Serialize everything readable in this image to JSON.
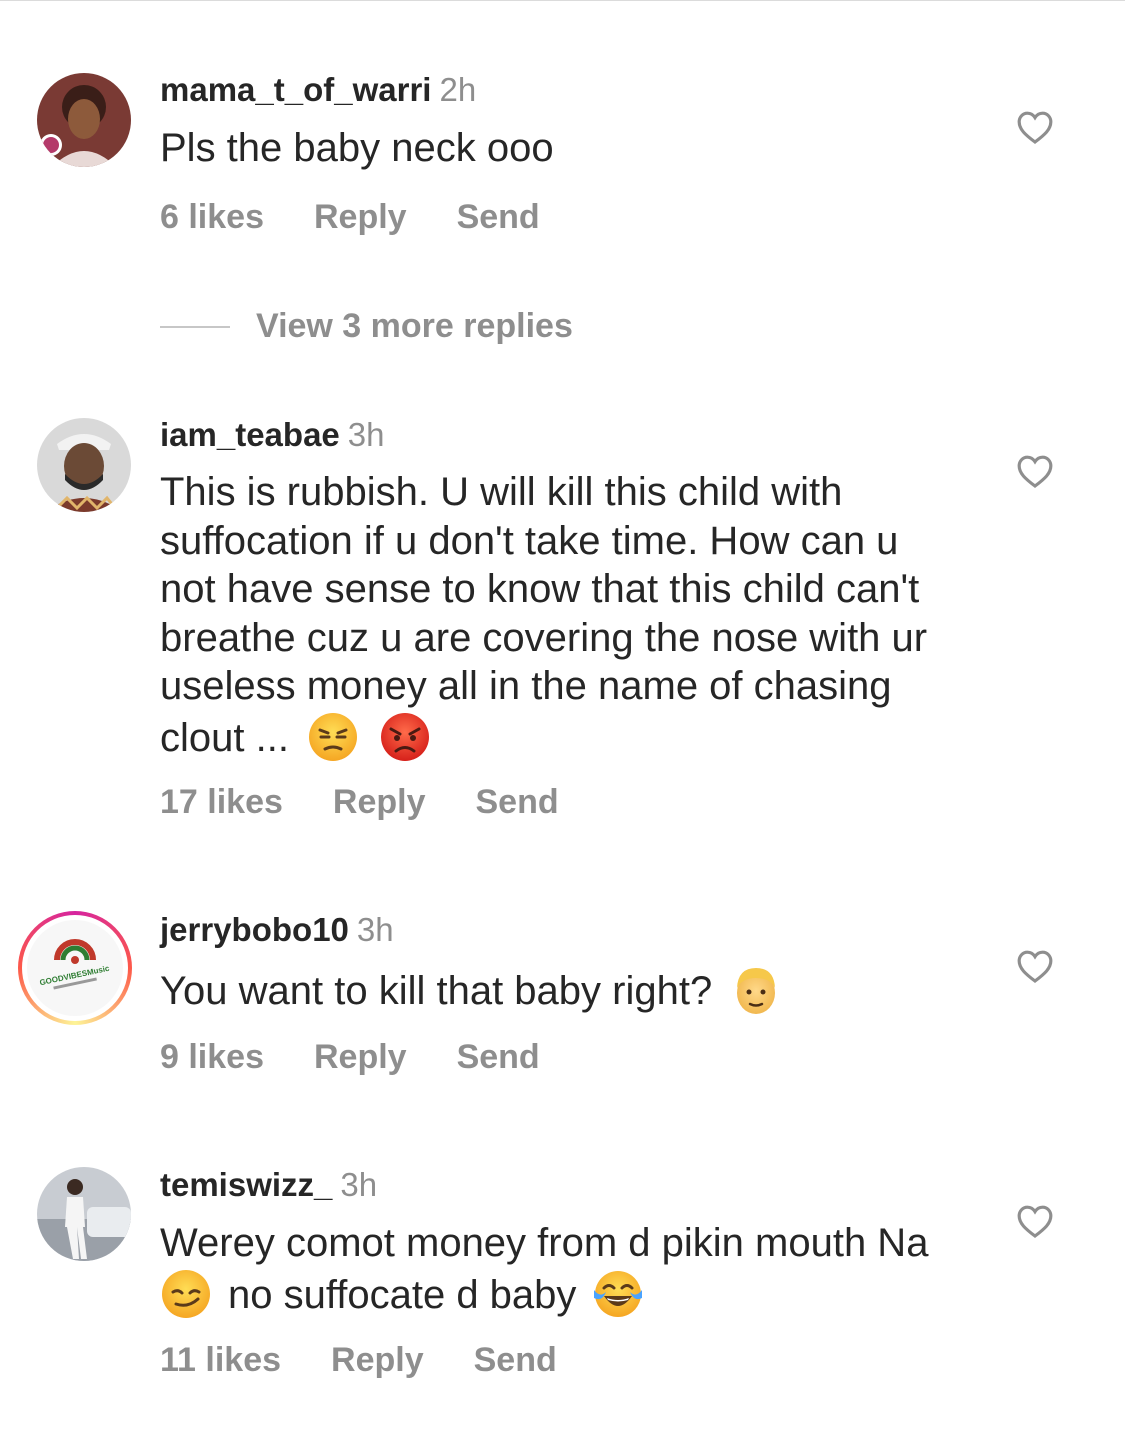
{
  "comments": [
    {
      "username": "mama_t_of_warri",
      "time": "2h",
      "text": "Pls the baby neck ooo",
      "likes": "6 likes",
      "reply": "Reply",
      "send": "Send"
    },
    {
      "username": "iam_teabae",
      "time": "3h",
      "text": "This is rubbish.  U will kill this child with suffocation if u don't take time. How can u not have sense to know that this child can't breathe cuz u are covering the nose with ur useless money all in the name of chasing clout ...",
      "likes": "17 likes",
      "reply": "Reply",
      "send": "Send"
    },
    {
      "username": "jerrybobo10",
      "time": "3h",
      "text": "You want to kill that baby right?",
      "likes": "9 likes",
      "reply": "Reply",
      "send": "Send",
      "avatar_logo_text": "GOODVIBESMusic"
    },
    {
      "username": "temiswizz_",
      "time": "3h",
      "text_part1": "Werey comot money from d pikin mouth Na",
      "text_part2": "no suffocate d baby",
      "likes": "11 likes",
      "reply": "Reply",
      "send": "Send"
    }
  ],
  "view_replies": "View 3 more replies",
  "icons": {
    "like": "heart-outline-icon",
    "emoji_1": "unamused-face-emoji",
    "emoji_2": "pouting-face-emoji",
    "emoji_3": "man-blond-hair-emoji",
    "emoji_4": "smirking-face-emoji",
    "emoji_5": "tears-of-joy-emoji"
  },
  "colors": {
    "text": "#262626",
    "secondary": "#8e8e8e",
    "story_ring_start": "#d6249f",
    "story_ring_end": "#fdf497"
  }
}
